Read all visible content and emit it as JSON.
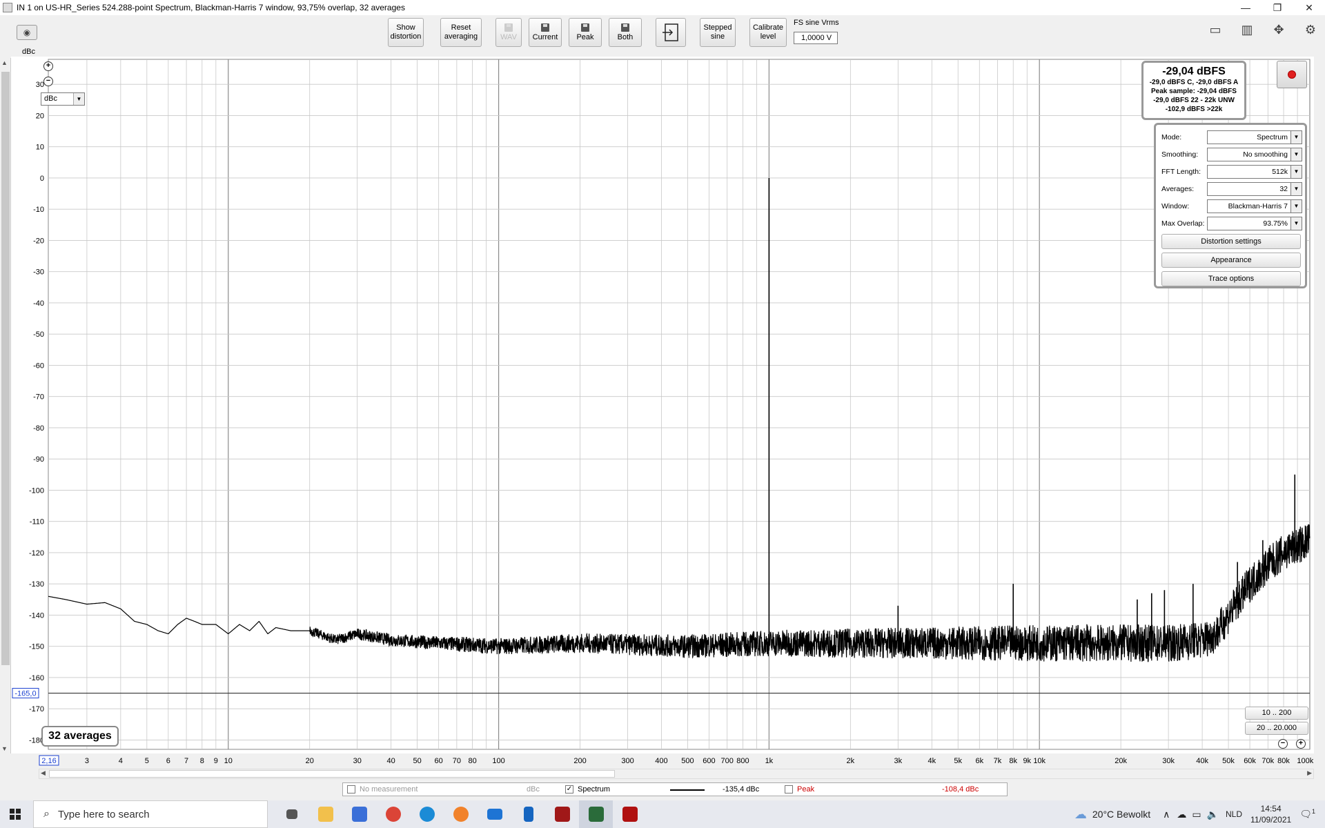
{
  "window": {
    "title": "IN 1 on US-HR_Series 524.288-point Spectrum, Blackman-Harris 7 window, 93,75% overlap, 32 averages",
    "controls": [
      "—",
      "❐",
      "✕"
    ]
  },
  "toolbar": {
    "show_distortion": [
      "Show",
      "distortion"
    ],
    "reset_averaging": [
      "Reset",
      "averaging"
    ],
    "wav": "WAV",
    "current": "Current",
    "peak": "Peak",
    "both": "Both",
    "stepped_sine": [
      "Stepped",
      "sine"
    ],
    "calibrate_level": [
      "Calibrate",
      "level"
    ],
    "fs_sine_label": "FS sine Vrms",
    "fs_sine_value": "1,0000 V"
  },
  "plot": {
    "unit_label": "dBc",
    "unit_select": "dBc",
    "averages_badge": "32 averages",
    "cursor_y_label": "-165,0",
    "x_start_label": "2,16"
  },
  "level_meter": {
    "main": "-29,04 dBFS",
    "lines": [
      "-29,0 dBFS C, -29,0 dBFS A",
      "Peak sample: -29,04 dBFS",
      "-29,0 dBFS 22 - 22k UNW",
      "-102,9 dBFS >22k"
    ]
  },
  "settings": {
    "rows": [
      {
        "label": "Mode:",
        "value": "Spectrum"
      },
      {
        "label": "Smoothing:",
        "value": "No  smoothing"
      },
      {
        "label": "FFT Length:",
        "value": "512k"
      },
      {
        "label": "Averages:",
        "value": "32"
      },
      {
        "label": "Window:",
        "value": "Blackman-Harris 7"
      },
      {
        "label": "Max Overlap:",
        "value": "93.75%"
      }
    ],
    "buttons": [
      "Distortion settings",
      "Appearance",
      "Trace options"
    ]
  },
  "range_buttons": [
    "10 .. 200",
    "20 .. 20.000"
  ],
  "legend": {
    "no_measurement": "No measurement",
    "no_measurement_unit": "dBc",
    "spectrum_label": "Spectrum",
    "spectrum_value": "-135,4 dBc",
    "peak_label": "Peak",
    "peak_value": "-108,4 dBc"
  },
  "taskbar": {
    "search_placeholder": "Type here to search",
    "weather": "20°C  Bewolkt",
    "lang": "NLD",
    "time": "14:54",
    "date": "11/09/2021",
    "notifications": "1"
  },
  "chart_data": {
    "type": "line",
    "title": "",
    "xlabel": "",
    "ylabel": "dBc",
    "x_scale": "log",
    "xlim": [
      2.16,
      100000
    ],
    "ylim": [
      -183,
      38
    ],
    "y_ticks": [
      30,
      20,
      10,
      0,
      -10,
      -20,
      -30,
      -40,
      -50,
      -60,
      -70,
      -80,
      -90,
      -100,
      -110,
      -120,
      -130,
      -140,
      -150,
      -160,
      -170,
      -180
    ],
    "x_tick_labels": [
      {
        "x": 3,
        "label": "3"
      },
      {
        "x": 4,
        "label": "4"
      },
      {
        "x": 5,
        "label": "5"
      },
      {
        "x": 6,
        "label": "6"
      },
      {
        "x": 7,
        "label": "7"
      },
      {
        "x": 8,
        "label": "8"
      },
      {
        "x": 9,
        "label": "9"
      },
      {
        "x": 10,
        "label": "10"
      },
      {
        "x": 20,
        "label": "20"
      },
      {
        "x": 30,
        "label": "30"
      },
      {
        "x": 40,
        "label": "40"
      },
      {
        "x": 50,
        "label": "50"
      },
      {
        "x": 60,
        "label": "60"
      },
      {
        "x": 70,
        "label": "70"
      },
      {
        "x": 80,
        "label": "80"
      },
      {
        "x": 100,
        "label": "100"
      },
      {
        "x": 200,
        "label": "200"
      },
      {
        "x": 300,
        "label": "300"
      },
      {
        "x": 400,
        "label": "400"
      },
      {
        "x": 500,
        "label": "500"
      },
      {
        "x": 600,
        "label": "600"
      },
      {
        "x": 700,
        "label": "700"
      },
      {
        "x": 800,
        "label": "800"
      },
      {
        "x": 1000,
        "label": "1k"
      },
      {
        "x": 2000,
        "label": "2k"
      },
      {
        "x": 3000,
        "label": "3k"
      },
      {
        "x": 4000,
        "label": "4k"
      },
      {
        "x": 5000,
        "label": "5k"
      },
      {
        "x": 6000,
        "label": "6k"
      },
      {
        "x": 7000,
        "label": "7k"
      },
      {
        "x": 8000,
        "label": "8k"
      },
      {
        "x": 9000,
        "label": "9k"
      },
      {
        "x": 10000,
        "label": "10k"
      },
      {
        "x": 20000,
        "label": "20k"
      },
      {
        "x": 30000,
        "label": "30k"
      },
      {
        "x": 40000,
        "label": "40k"
      },
      {
        "x": 50000,
        "label": "50k"
      },
      {
        "x": 60000,
        "label": "60k"
      },
      {
        "x": 70000,
        "label": "70k"
      },
      {
        "x": 80000,
        "label": "80k"
      },
      {
        "x": 100000,
        "label": "100kHz"
      }
    ],
    "grid": true,
    "cursor_level": -165,
    "series": [
      {
        "name": "Spectrum",
        "color": "#000000",
        "points": [
          [
            2.16,
            -134
          ],
          [
            2.5,
            -135
          ],
          [
            3,
            -136.5
          ],
          [
            3.5,
            -136
          ],
          [
            4,
            -138
          ],
          [
            4.5,
            -142
          ],
          [
            5,
            -143
          ],
          [
            5.5,
            -145
          ],
          [
            6,
            -146
          ],
          [
            6.5,
            -143
          ],
          [
            7,
            -141
          ],
          [
            7.5,
            -142
          ],
          [
            8,
            -143
          ],
          [
            9,
            -143
          ],
          [
            10,
            -146
          ],
          [
            11,
            -143
          ],
          [
            12,
            -145
          ],
          [
            13,
            -142
          ],
          [
            14,
            -146
          ],
          [
            15,
            -144
          ],
          [
            17,
            -145
          ],
          [
            20,
            -145
          ],
          [
            25,
            -148
          ],
          [
            30,
            -146
          ],
          [
            40,
            -148
          ],
          [
            60,
            -149
          ],
          [
            100,
            -150
          ],
          [
            200,
            -149
          ],
          [
            500,
            -150
          ],
          [
            1000,
            -149
          ],
          [
            2000,
            -149
          ],
          [
            5000,
            -149
          ],
          [
            10000,
            -149
          ],
          [
            20000,
            -149
          ],
          [
            30000,
            -149
          ],
          [
            40000,
            -148
          ],
          [
            45000,
            -146
          ],
          [
            50000,
            -140
          ],
          [
            60000,
            -130
          ],
          [
            70000,
            -124
          ],
          [
            80000,
            -120
          ],
          [
            100000,
            -116
          ]
        ],
        "noise_floor_band": [
          -154,
          -143
        ],
        "spikes": [
          [
            1000,
            0
          ],
          [
            3000,
            -137
          ],
          [
            8000,
            -130
          ],
          [
            23000,
            -135
          ],
          [
            26000,
            -133
          ],
          [
            29000,
            -132
          ],
          [
            37000,
            -130
          ],
          [
            54000,
            -123
          ],
          [
            67000,
            -116
          ],
          [
            88000,
            -95
          ]
        ]
      }
    ]
  },
  "colors": {
    "plot_bg": "#ffffff",
    "grid": "#c8c8c8",
    "trace": "#000000",
    "peak_legend": "#cc0000",
    "cursor_label": "#1a3fd1"
  }
}
